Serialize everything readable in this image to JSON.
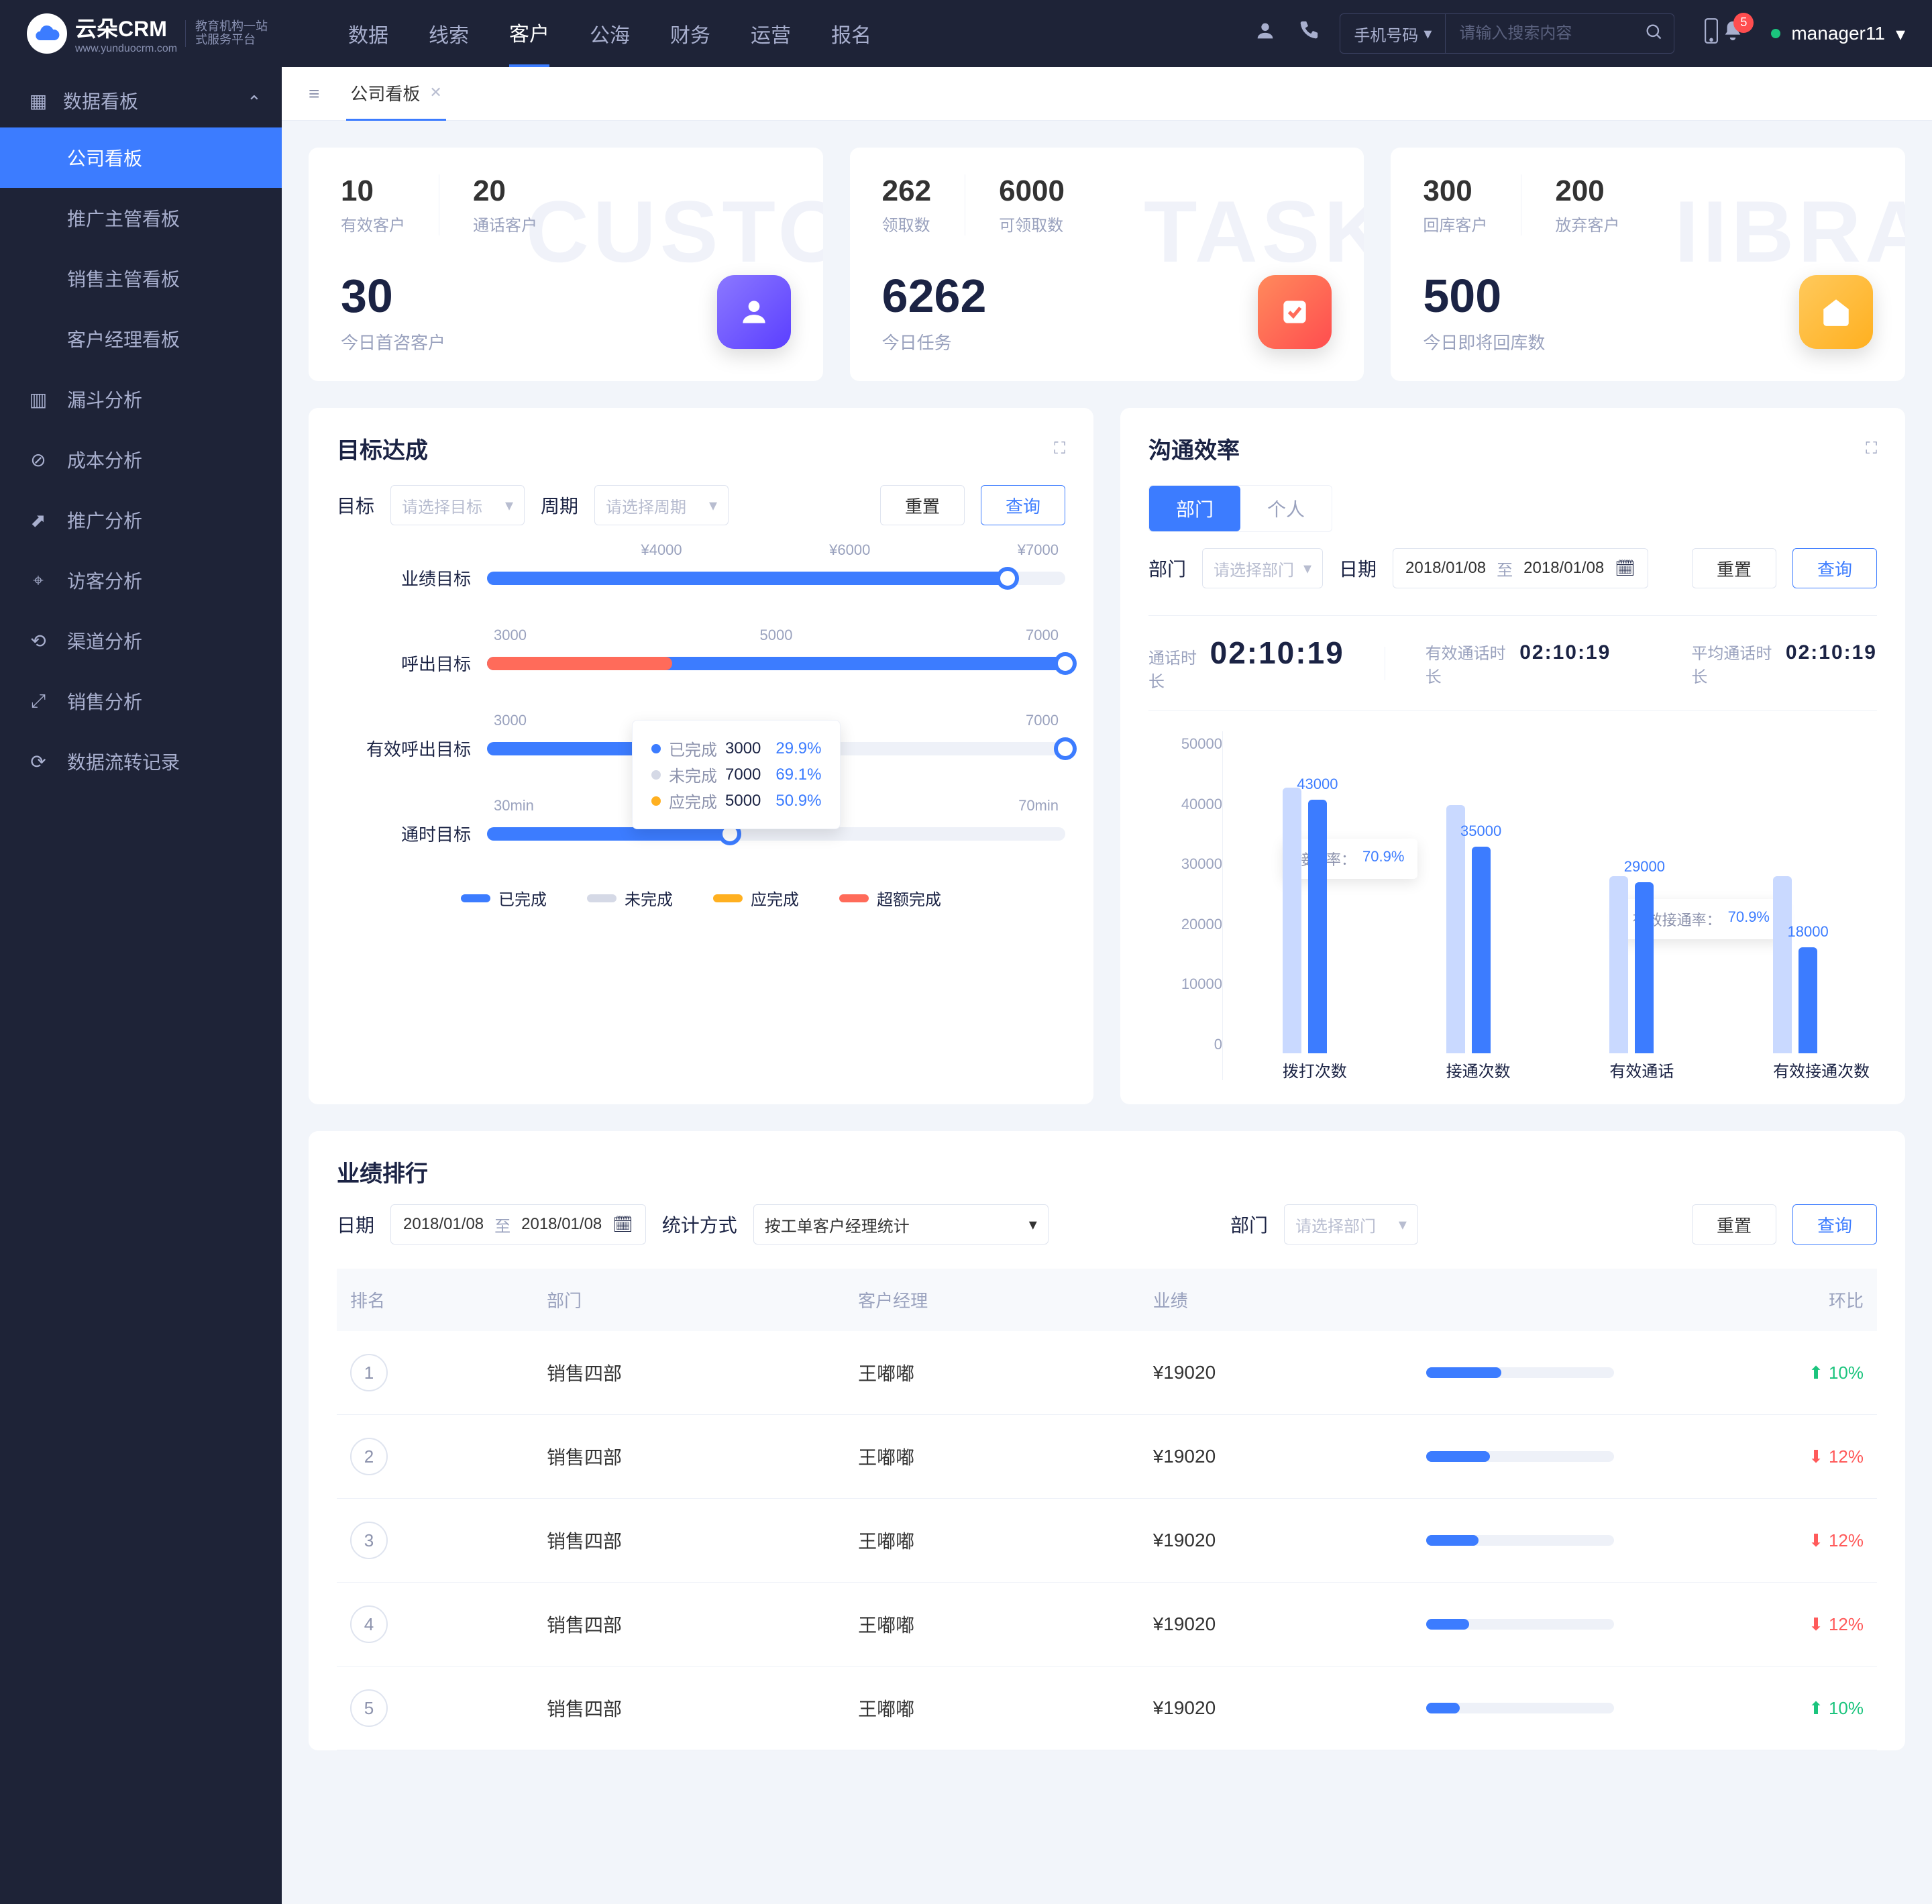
{
  "brand": {
    "name": "云朵CRM",
    "sub1": "教育机构一站",
    "sub2": "式服务平台"
  },
  "topnav": {
    "items": [
      "数据",
      "线索",
      "客户",
      "公海",
      "财务",
      "运营",
      "报名"
    ],
    "active": 2
  },
  "search": {
    "type": "手机号码",
    "placeholder": "请输入搜索内容"
  },
  "badge": "5",
  "user": "manager11",
  "sidebar": {
    "group": "数据看板",
    "items": [
      "公司看板",
      "推广主管看板",
      "销售主管看板",
      "客户经理看板"
    ],
    "active": 0,
    "singles": [
      "漏斗分析",
      "成本分析",
      "推广分析",
      "访客分析",
      "渠道分析",
      "销售分析",
      "数据流转记录"
    ]
  },
  "tab": {
    "label": "公司看板"
  },
  "cards": [
    {
      "ghost": "CUSTO",
      "top": [
        {
          "v": "10",
          "l": "有效客户"
        },
        {
          "v": "20",
          "l": "通话客户"
        }
      ],
      "big": {
        "v": "30",
        "l": "今日首咨客户"
      }
    },
    {
      "ghost": "TASK",
      "top": [
        {
          "v": "262",
          "l": "领取数"
        },
        {
          "v": "6000",
          "l": "可领取数"
        }
      ],
      "big": {
        "v": "6262",
        "l": "今日任务"
      }
    },
    {
      "ghost": "IIBRA",
      "top": [
        {
          "v": "300",
          "l": "回库客户"
        },
        {
          "v": "200",
          "l": "放弃客户"
        }
      ],
      "big": {
        "v": "500",
        "l": "今日即将回库数"
      }
    }
  ],
  "targets": {
    "title": "目标达成",
    "goal_label": "目标",
    "goal_ph": "请选择目标",
    "period_label": "周期",
    "period_ph": "请选择周期",
    "reset": "重置",
    "query": "查询",
    "legend": {
      "done": "已完成",
      "undone": "未完成",
      "should": "应完成",
      "over": "超额完成"
    },
    "tooltip": {
      "done": {
        "l": "已完成",
        "n": "3000",
        "p": "29.9%"
      },
      "undone": {
        "l": "未完成",
        "n": "7000",
        "p": "69.1%"
      },
      "should": {
        "l": "应完成",
        "n": "5000",
        "p": "50.9%"
      }
    }
  },
  "comm": {
    "title": "沟通效率",
    "tabs": {
      "dept": "部门",
      "person": "个人"
    },
    "dept_label": "部门",
    "dept_ph": "请选择部门",
    "date_label": "日期",
    "from": "2018/01/08",
    "to": "至",
    "to_date": "2018/01/08",
    "reset": "重置",
    "query": "查询",
    "m1_l": "通话时长",
    "m1_v": "02:10:19",
    "m2_l": "有效通话时长",
    "m2_v": "02:10:19",
    "m3_l": "平均通话时长",
    "m3_v": "02:10:19",
    "callout1": {
      "l": "接通率：",
      "v": "70.9%"
    },
    "callout2": {
      "l": "有效接通率：",
      "v": "70.9%"
    }
  },
  "chart_data": {
    "type": "bar",
    "ylim": [
      0,
      50000
    ],
    "yticks": [
      "50000",
      "40000",
      "30000",
      "20000",
      "10000",
      "0"
    ],
    "categories": [
      "拨打次数",
      "接通次数",
      "有效通话",
      "有效接通次数"
    ],
    "series": [
      {
        "name": "light",
        "values": [
          45000,
          42000,
          30000,
          30000
        ]
      },
      {
        "name": "blue",
        "values": [
          43000,
          35000,
          29000,
          18000
        ]
      }
    ],
    "labels": [
      "43000",
      "35000",
      "29000",
      "18000"
    ]
  },
  "rank": {
    "title": "业绩排行",
    "date_label": "日期",
    "from": "2018/01/08",
    "to": "至",
    "to_date": "2018/01/08",
    "method_label": "统计方式",
    "method_val": "按工单客户经理统计",
    "dept_label": "部门",
    "dept_ph": "请选择部门",
    "reset": "重置",
    "query": "查询",
    "head": {
      "rank": "排名",
      "dept": "部门",
      "mgr": "客户经理",
      "perf": "业绩",
      "yoy": "环比"
    },
    "rows": [
      {
        "r": "1",
        "d": "销售四部",
        "m": "王嘟嘟",
        "p": "¥19020",
        "w": 40,
        "dir": "up",
        "pct": "10%"
      },
      {
        "r": "2",
        "d": "销售四部",
        "m": "王嘟嘟",
        "p": "¥19020",
        "w": 34,
        "dir": "down",
        "pct": "12%"
      },
      {
        "r": "3",
        "d": "销售四部",
        "m": "王嘟嘟",
        "p": "¥19020",
        "w": 28,
        "dir": "down",
        "pct": "12%"
      },
      {
        "r": "4",
        "d": "销售四部",
        "m": "王嘟嘟",
        "p": "¥19020",
        "w": 23,
        "dir": "down",
        "pct": "12%"
      },
      {
        "r": "5",
        "d": "销售四部",
        "m": "王嘟嘟",
        "p": "¥19020",
        "w": 18,
        "dir": "up",
        "pct": "10%"
      }
    ]
  }
}
